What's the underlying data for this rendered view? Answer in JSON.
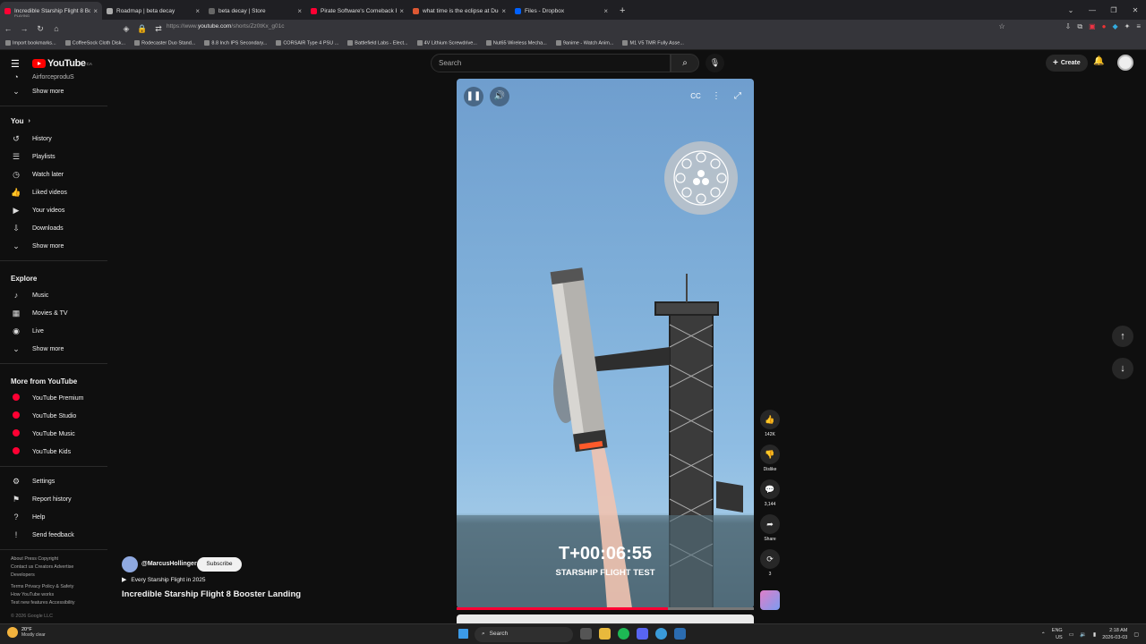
{
  "browser": {
    "tabs": [
      {
        "label": "Incredible Starship Flight 8 Boo",
        "sublabel": "PLAYING",
        "active": true,
        "fav": "#ff0033"
      },
      {
        "label": "Roadmap | beta decay",
        "active": false,
        "fav": "#aaaaaa"
      },
      {
        "label": "beta decay | Store",
        "active": false,
        "fav": "#666666"
      },
      {
        "label": "Pirate Software's Comeback Bu",
        "active": false,
        "fav": "#ff0033"
      },
      {
        "label": "what time is the eclipse at Duc",
        "active": false,
        "fav": "#de5833"
      },
      {
        "label": "Files - Dropbox",
        "active": false,
        "fav": "#0061fe"
      }
    ],
    "url_prefix": "https://www.",
    "url_host": "youtube.com",
    "url_path": "/shorts/Zz0tKx_g01c",
    "bookmarks": [
      "Import bookmarks...",
      "CoffeeSock Cloth Disk...",
      "Rodecaster Duo Stand...",
      "8.8 Inch IPS Secondary...",
      "CORSAIR Type 4 PSU ...",
      "Battlefield Labs - Elect...",
      "4V Lithium Screwdrive...",
      "Nut65 Wireless Mecha...",
      "9anime - Watch Anim...",
      "M1 V5 TMR Fully Asse..."
    ]
  },
  "header": {
    "logo_text": "YouTube",
    "country": "CA",
    "search_placeholder": "Search",
    "create_label": "Create"
  },
  "sidebar": {
    "top_truncated": "AirforceproduS",
    "show_more_1": "Show more",
    "you_label": "You",
    "you_items": [
      "History",
      "Playlists",
      "Watch later",
      "Liked videos",
      "Your videos",
      "Downloads"
    ],
    "show_more_2": "Show more",
    "explore_label": "Explore",
    "explore_items": [
      "Music",
      "Movies & TV",
      "Live"
    ],
    "show_more_3": "Show more",
    "more_label": "More from YouTube",
    "more_items": [
      "YouTube Premium",
      "YouTube Studio",
      "YouTube Music",
      "YouTube Kids"
    ],
    "settings_items": [
      "Settings",
      "Report history",
      "Help",
      "Send feedback"
    ],
    "footer_1": "About  Press  Copyright",
    "footer_2": "Contact us  Creators  Advertise",
    "footer_3": "Developers",
    "footer_4": "Terms  Privacy  Policy & Safety",
    "footer_5": "How YouTube works",
    "footer_6": "Test new features  Accessibility",
    "copyright": "© 2026 Google LLC"
  },
  "video": {
    "timer": "T+00:06:55",
    "caption": "STARSHIP FLIGHT TEST",
    "progress": 0.71
  },
  "actions": {
    "likes": "142K",
    "dislike": "Dislike",
    "comments": "3,144",
    "share": "Share",
    "remix": "3"
  },
  "meta": {
    "channel": "@MarcusHollinger",
    "subscribe": "Subscribe",
    "playlist": "Every Starship Flight in 2025",
    "title": "Incredible Starship Flight 8 Booster Landing"
  },
  "taskbar": {
    "temp": "20°F",
    "condition": "Mostly clear",
    "search": "Search",
    "lang1": "ENG",
    "lang2": "US",
    "time": "2:18 AM",
    "date": "2026-03-03"
  }
}
